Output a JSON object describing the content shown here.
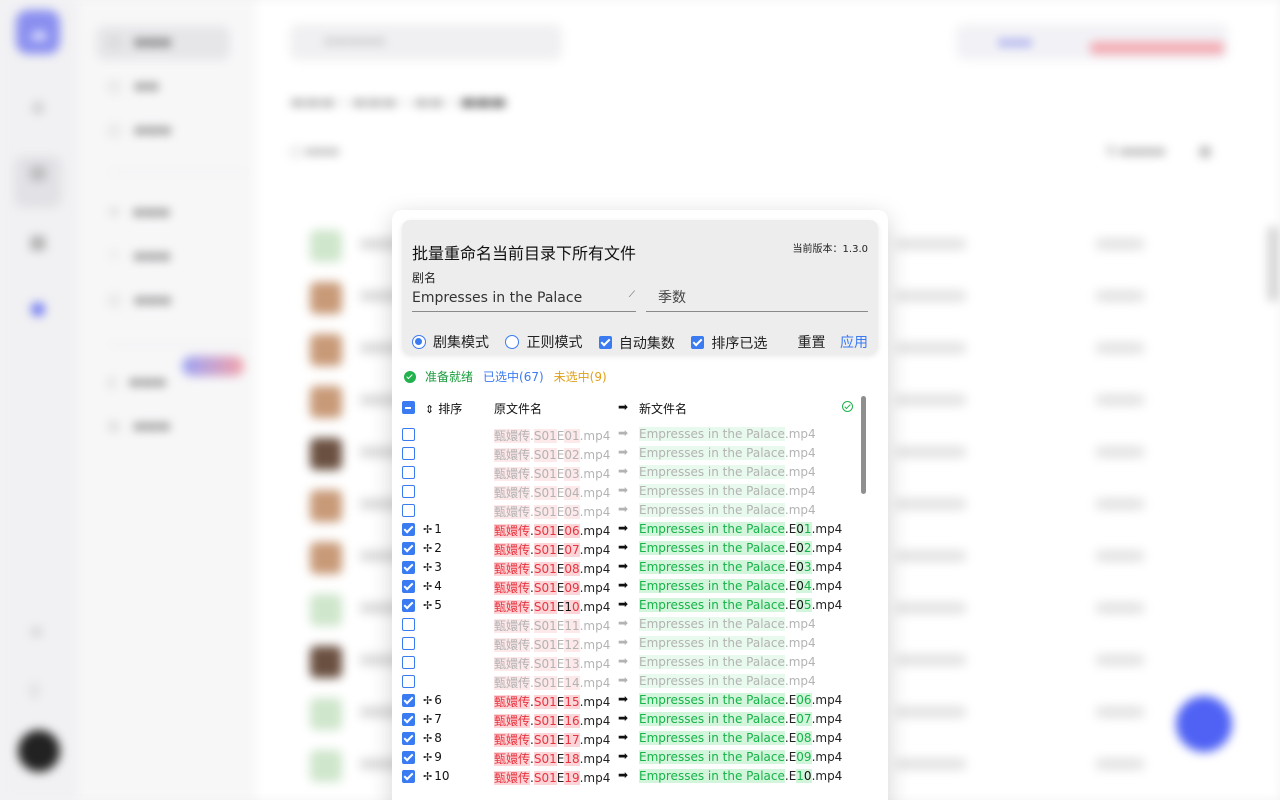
{
  "dialog": {
    "title": "批量重命名当前目录下所有文件",
    "version": "当前版本：1.3.0",
    "show_label": "剧名",
    "show_value": "Empresses in the Palace",
    "season_placeholder": "季数",
    "modes": [
      {
        "label": "剧集模式",
        "selected": true
      },
      {
        "label": "正则模式",
        "selected": false
      }
    ],
    "options": [
      {
        "label": "自动集数",
        "checked": true
      },
      {
        "label": "排序已选",
        "checked": true
      }
    ],
    "reset_label": "重置",
    "apply_label": "应用",
    "status_ready": "准备就绪",
    "status_selected": "已选中(67)",
    "status_unselected": "未选中(9)",
    "col_sort": "排序",
    "col_original": "原文件名",
    "col_arrow": "➡",
    "col_new": "新文件名",
    "rows": [
      {
        "checked": false,
        "index": "",
        "orig": [
          [
            "甄嬛传",
            "p"
          ],
          [
            ".",
            ""
          ],
          [
            "S01",
            "p"
          ],
          [
            "E",
            ""
          ],
          [
            "01",
            "p"
          ],
          [
            ".mp4",
            ""
          ]
        ],
        "new": [
          [
            "Empresses in the Palace",
            "p"
          ],
          [
            ".mp4",
            ""
          ]
        ]
      },
      {
        "checked": false,
        "index": "",
        "orig": [
          [
            "甄嬛传",
            "p"
          ],
          [
            ".",
            ""
          ],
          [
            "S01",
            "p"
          ],
          [
            "E",
            ""
          ],
          [
            "02",
            "p"
          ],
          [
            ".mp4",
            ""
          ]
        ],
        "new": [
          [
            "Empresses in the Palace",
            "p"
          ],
          [
            ".mp4",
            ""
          ]
        ]
      },
      {
        "checked": false,
        "index": "",
        "orig": [
          [
            "甄嬛传",
            "p"
          ],
          [
            ".",
            ""
          ],
          [
            "S01",
            "p"
          ],
          [
            "E",
            ""
          ],
          [
            "03",
            "p"
          ],
          [
            ".mp4",
            ""
          ]
        ],
        "new": [
          [
            "Empresses in the Palace",
            "p"
          ],
          [
            ".mp4",
            ""
          ]
        ]
      },
      {
        "checked": false,
        "index": "",
        "orig": [
          [
            "甄嬛传",
            "p"
          ],
          [
            ".",
            ""
          ],
          [
            "S01",
            "p"
          ],
          [
            "E",
            ""
          ],
          [
            "04",
            "p"
          ],
          [
            ".mp4",
            ""
          ]
        ],
        "new": [
          [
            "Empresses in the Palace",
            "p"
          ],
          [
            ".mp4",
            ""
          ]
        ]
      },
      {
        "checked": false,
        "index": "",
        "orig": [
          [
            "甄嬛传",
            "p"
          ],
          [
            ".",
            ""
          ],
          [
            "S01",
            "p"
          ],
          [
            "E",
            ""
          ],
          [
            "05",
            "p"
          ],
          [
            ".mp4",
            ""
          ]
        ],
        "new": [
          [
            "Empresses in the Palace",
            "p"
          ],
          [
            ".mp4",
            ""
          ]
        ]
      },
      {
        "checked": true,
        "index": "1",
        "orig": [
          [
            "甄嬛传",
            "p"
          ],
          [
            ".",
            ""
          ],
          [
            "S01",
            "p"
          ],
          [
            "E",
            ""
          ],
          [
            "06",
            "p"
          ],
          [
            ".mp4",
            ""
          ]
        ],
        "new": [
          [
            "Empresses in the Palace",
            "p"
          ],
          [
            ".E",
            ""
          ],
          [
            "0",
            "x"
          ],
          [
            "1",
            "p"
          ],
          [
            ".mp4",
            ""
          ]
        ]
      },
      {
        "checked": true,
        "index": "2",
        "orig": [
          [
            "甄嬛传",
            "p"
          ],
          [
            ".",
            ""
          ],
          [
            "S01",
            "p"
          ],
          [
            "E",
            ""
          ],
          [
            "07",
            "p"
          ],
          [
            ".mp4",
            ""
          ]
        ],
        "new": [
          [
            "Empresses in the Palace",
            "p"
          ],
          [
            ".E",
            ""
          ],
          [
            "0",
            "x"
          ],
          [
            "2",
            "p"
          ],
          [
            ".mp4",
            ""
          ]
        ]
      },
      {
        "checked": true,
        "index": "3",
        "orig": [
          [
            "甄嬛传",
            "p"
          ],
          [
            ".",
            ""
          ],
          [
            "S01",
            "p"
          ],
          [
            "E",
            ""
          ],
          [
            "08",
            "p"
          ],
          [
            ".mp4",
            ""
          ]
        ],
        "new": [
          [
            "Empresses in the Palace",
            "p"
          ],
          [
            ".E",
            ""
          ],
          [
            "0",
            "x"
          ],
          [
            "3",
            "p"
          ],
          [
            ".mp4",
            ""
          ]
        ]
      },
      {
        "checked": true,
        "index": "4",
        "orig": [
          [
            "甄嬛传",
            "p"
          ],
          [
            ".",
            ""
          ],
          [
            "S01",
            "p"
          ],
          [
            "E",
            ""
          ],
          [
            "09",
            "p"
          ],
          [
            ".mp4",
            ""
          ]
        ],
        "new": [
          [
            "Empresses in the Palace",
            "p"
          ],
          [
            ".E",
            ""
          ],
          [
            "0",
            "x"
          ],
          [
            "4",
            "p"
          ],
          [
            ".mp4",
            ""
          ]
        ]
      },
      {
        "checked": true,
        "index": "5",
        "orig": [
          [
            "甄嬛传",
            "p"
          ],
          [
            ".",
            ""
          ],
          [
            "S01",
            "p"
          ],
          [
            "E",
            ""
          ],
          [
            "1",
            "x"
          ],
          [
            "0",
            "p"
          ],
          [
            ".mp4",
            ""
          ]
        ],
        "new": [
          [
            "Empresses in the Palace",
            "p"
          ],
          [
            ".E",
            ""
          ],
          [
            "0",
            "x"
          ],
          [
            "5",
            "p"
          ],
          [
            ".mp4",
            ""
          ]
        ]
      },
      {
        "checked": false,
        "index": "",
        "orig": [
          [
            "甄嬛传",
            "p"
          ],
          [
            ".",
            ""
          ],
          [
            "S01",
            "p"
          ],
          [
            "E",
            ""
          ],
          [
            "11",
            "p"
          ],
          [
            ".mp4",
            ""
          ]
        ],
        "new": [
          [
            "Empresses in the Palace",
            "p"
          ],
          [
            ".mp4",
            ""
          ]
        ]
      },
      {
        "checked": false,
        "index": "",
        "orig": [
          [
            "甄嬛传",
            "p"
          ],
          [
            ".",
            ""
          ],
          [
            "S01",
            "p"
          ],
          [
            "E",
            ""
          ],
          [
            "12",
            "p"
          ],
          [
            ".mp4",
            ""
          ]
        ],
        "new": [
          [
            "Empresses in the Palace",
            "p"
          ],
          [
            ".mp4",
            ""
          ]
        ]
      },
      {
        "checked": false,
        "index": "",
        "orig": [
          [
            "甄嬛传",
            "p"
          ],
          [
            ".",
            ""
          ],
          [
            "S01",
            "p"
          ],
          [
            "E",
            ""
          ],
          [
            "13",
            "p"
          ],
          [
            ".mp4",
            ""
          ]
        ],
        "new": [
          [
            "Empresses in the Palace",
            "p"
          ],
          [
            ".mp4",
            ""
          ]
        ]
      },
      {
        "checked": false,
        "index": "",
        "orig": [
          [
            "甄嬛传",
            "p"
          ],
          [
            ".",
            ""
          ],
          [
            "S01",
            "p"
          ],
          [
            "E",
            ""
          ],
          [
            "14",
            "p"
          ],
          [
            ".mp4",
            ""
          ]
        ],
        "new": [
          [
            "Empresses in the Palace",
            "p"
          ],
          [
            ".mp4",
            ""
          ]
        ]
      },
      {
        "checked": true,
        "index": "6",
        "orig": [
          [
            "甄嬛传",
            "p"
          ],
          [
            ".",
            ""
          ],
          [
            "S01",
            "p"
          ],
          [
            "E",
            ""
          ],
          [
            "15",
            "p"
          ],
          [
            ".mp4",
            ""
          ]
        ],
        "new": [
          [
            "Empresses in the Palace",
            "p"
          ],
          [
            ".E",
            ""
          ],
          [
            "06",
            "p"
          ],
          [
            ".mp4",
            ""
          ]
        ]
      },
      {
        "checked": true,
        "index": "7",
        "orig": [
          [
            "甄嬛传",
            "p"
          ],
          [
            ".",
            ""
          ],
          [
            "S01",
            "p"
          ],
          [
            "E",
            ""
          ],
          [
            "16",
            "p"
          ],
          [
            ".mp4",
            ""
          ]
        ],
        "new": [
          [
            "Empresses in the Palace",
            "p"
          ],
          [
            ".E",
            ""
          ],
          [
            "07",
            "p"
          ],
          [
            ".mp4",
            ""
          ]
        ]
      },
      {
        "checked": true,
        "index": "8",
        "orig": [
          [
            "甄嬛传",
            "p"
          ],
          [
            ".",
            ""
          ],
          [
            "S01",
            "p"
          ],
          [
            "E",
            ""
          ],
          [
            "17",
            "p"
          ],
          [
            ".mp4",
            ""
          ]
        ],
        "new": [
          [
            "Empresses in the Palace",
            "p"
          ],
          [
            ".E",
            ""
          ],
          [
            "08",
            "p"
          ],
          [
            ".mp4",
            ""
          ]
        ]
      },
      {
        "checked": true,
        "index": "9",
        "orig": [
          [
            "甄嬛传",
            "p"
          ],
          [
            ".",
            ""
          ],
          [
            "S01",
            "p"
          ],
          [
            "E",
            ""
          ],
          [
            "18",
            "p"
          ],
          [
            ".mp4",
            ""
          ]
        ],
        "new": [
          [
            "Empresses in the Palace",
            "p"
          ],
          [
            ".E",
            ""
          ],
          [
            "09",
            "p"
          ],
          [
            ".mp4",
            ""
          ]
        ]
      },
      {
        "checked": true,
        "index": "10",
        "orig": [
          [
            "甄嬛传",
            "p"
          ],
          [
            ".",
            ""
          ],
          [
            "S01",
            "p"
          ],
          [
            "E",
            ""
          ],
          [
            "19",
            "p"
          ],
          [
            ".mp4",
            ""
          ]
        ],
        "new": [
          [
            "Empresses in the Palace",
            "p"
          ],
          [
            ".E",
            ""
          ],
          [
            "1",
            "p"
          ],
          [
            "0",
            "x"
          ],
          [
            ".mp4",
            ""
          ]
        ]
      }
    ]
  },
  "colors": {
    "accent": "#3b7bf2",
    "ok": "#1a9d3c",
    "warn": "#e0a019",
    "old_part": "#e8343f",
    "new_part": "#16b348"
  },
  "icons": {
    "drag_handle": "move-icon",
    "arrow": "arrow-right-icon",
    "sort": "sort-icon",
    "ready": "check-circle-icon"
  }
}
